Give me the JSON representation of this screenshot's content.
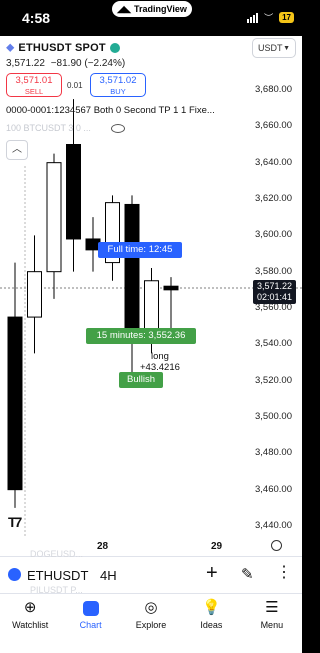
{
  "status": {
    "time": "4:58",
    "app_pill": "TradingView",
    "battery": "17"
  },
  "header": {
    "symbol": "ETHUSDT SPOT",
    "quote_currency": "USDT",
    "last_price": "3,571.22",
    "change": "−81.90 (−2.24%)",
    "sell_price": "3,571.01",
    "sell_label": "SELL",
    "spread": "0.01",
    "buy_price": "3,571.02",
    "buy_label": "BUY",
    "strategy": "0000-0001:1234567 Both 0 Second TP 1 1 Fixe...",
    "overlay_symbol": "100 BTCUSDT 3 0 ..."
  },
  "chart_data": {
    "type": "candlestick",
    "price_axis": [
      "3,680.00",
      "3,660.00",
      "3,640.00",
      "3,620.00",
      "3,600.00",
      "3,580.00",
      "3,560.00",
      "3,540.00",
      "3,520.00",
      "3,500.00",
      "3,480.00",
      "3,460.00",
      "3,440.00"
    ],
    "x_ticks": [
      "28",
      "29"
    ],
    "y_range": [
      3440,
      3680
    ],
    "current_price": "3,571.22",
    "countdown": "02:01:41",
    "candles": [
      {
        "o": 3555,
        "h": 3585,
        "l": 3450,
        "c": 3460
      },
      {
        "o": 3555,
        "h": 3600,
        "l": 3535,
        "c": 3580
      },
      {
        "o": 3580,
        "h": 3645,
        "l": 3565,
        "c": 3640
      },
      {
        "o": 3650,
        "h": 3675,
        "l": 3580,
        "c": 3598
      },
      {
        "o": 3598,
        "h": 3610,
        "l": 3580,
        "c": 3592
      },
      {
        "o": 3585,
        "h": 3622,
        "l": 3575,
        "c": 3618
      },
      {
        "o": 3617,
        "h": 3622,
        "l": 3522,
        "c": 3545
      },
      {
        "o": 3545,
        "h": 3582,
        "l": 3535,
        "c": 3575
      },
      {
        "o": 3572,
        "h": 3577,
        "l": 3547,
        "c": 3570
      }
    ],
    "tooltip_time": "Full time: 12:45",
    "minute_label": "15 minutes: 3,552.36",
    "trade_label": "long",
    "trade_value": "+43.4216",
    "signal_label": "Bullish"
  },
  "bottom_bar": {
    "symbol": "ETHUSDT",
    "timeframe": "4H",
    "ghost_lines": [
      "DOGEUSD...",
      "PILUSDT P..."
    ]
  },
  "nav": [
    {
      "label": "Watchlist",
      "icon": "plus-circle-icon"
    },
    {
      "label": "Chart",
      "icon": "chart-icon"
    },
    {
      "label": "Explore",
      "icon": "compass-icon"
    },
    {
      "label": "Ideas",
      "icon": "lightbulb-icon"
    },
    {
      "label": "Menu",
      "icon": "hamburger-icon"
    }
  ],
  "colors": {
    "up": "#ffffff",
    "down": "#000000",
    "accent": "#2962ff",
    "green": "#43a047",
    "sell": "#f23645"
  }
}
